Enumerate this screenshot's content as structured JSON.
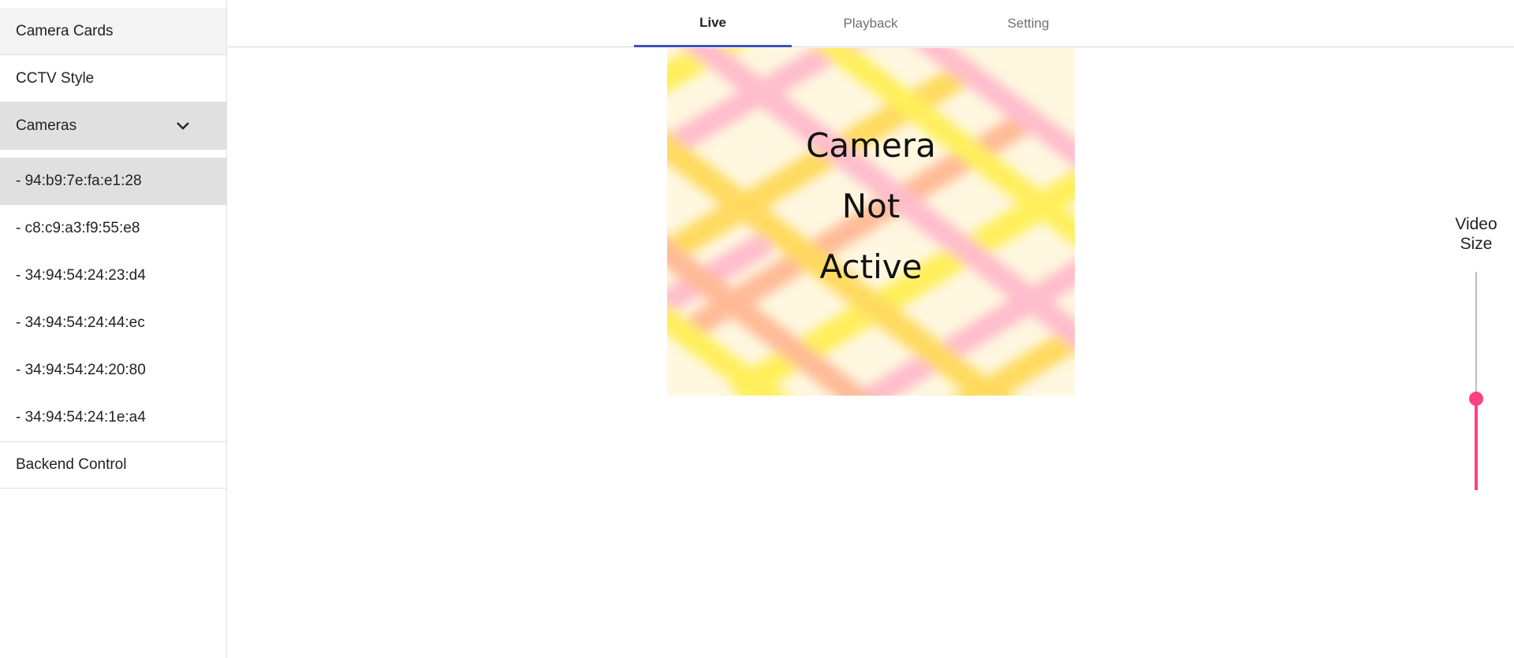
{
  "sidebar": {
    "items": [
      {
        "label": "Camera Cards"
      },
      {
        "label": "CCTV Style"
      },
      {
        "label": "Cameras"
      }
    ],
    "cameras": [
      {
        "label": "- 94:b9:7e:fa:e1:28"
      },
      {
        "label": "- c8:c9:a3:f9:55:e8"
      },
      {
        "label": "- 34:94:54:24:23:d4"
      },
      {
        "label": "- 34:94:54:24:44:ec"
      },
      {
        "label": "- 34:94:54:24:20:80"
      },
      {
        "label": "- 34:94:54:24:1e:a4"
      }
    ],
    "backend_label": "Backend Control",
    "active_camera": "- 94:b9:7e:fa:e1:28"
  },
  "tabs": [
    {
      "label": "Live"
    },
    {
      "label": "Playback"
    },
    {
      "label": "Setting"
    }
  ],
  "active_tab": "Live",
  "video": {
    "lines": [
      "Camera",
      "Not",
      "Active"
    ]
  },
  "video_size": {
    "label_line1": "Video",
    "label_line2": "Size",
    "value_fraction": 0.42
  },
  "colors": {
    "accent": "#ff4081",
    "tab_indicator": "#3f51b5",
    "selected_bg": "#e0e0e0"
  }
}
